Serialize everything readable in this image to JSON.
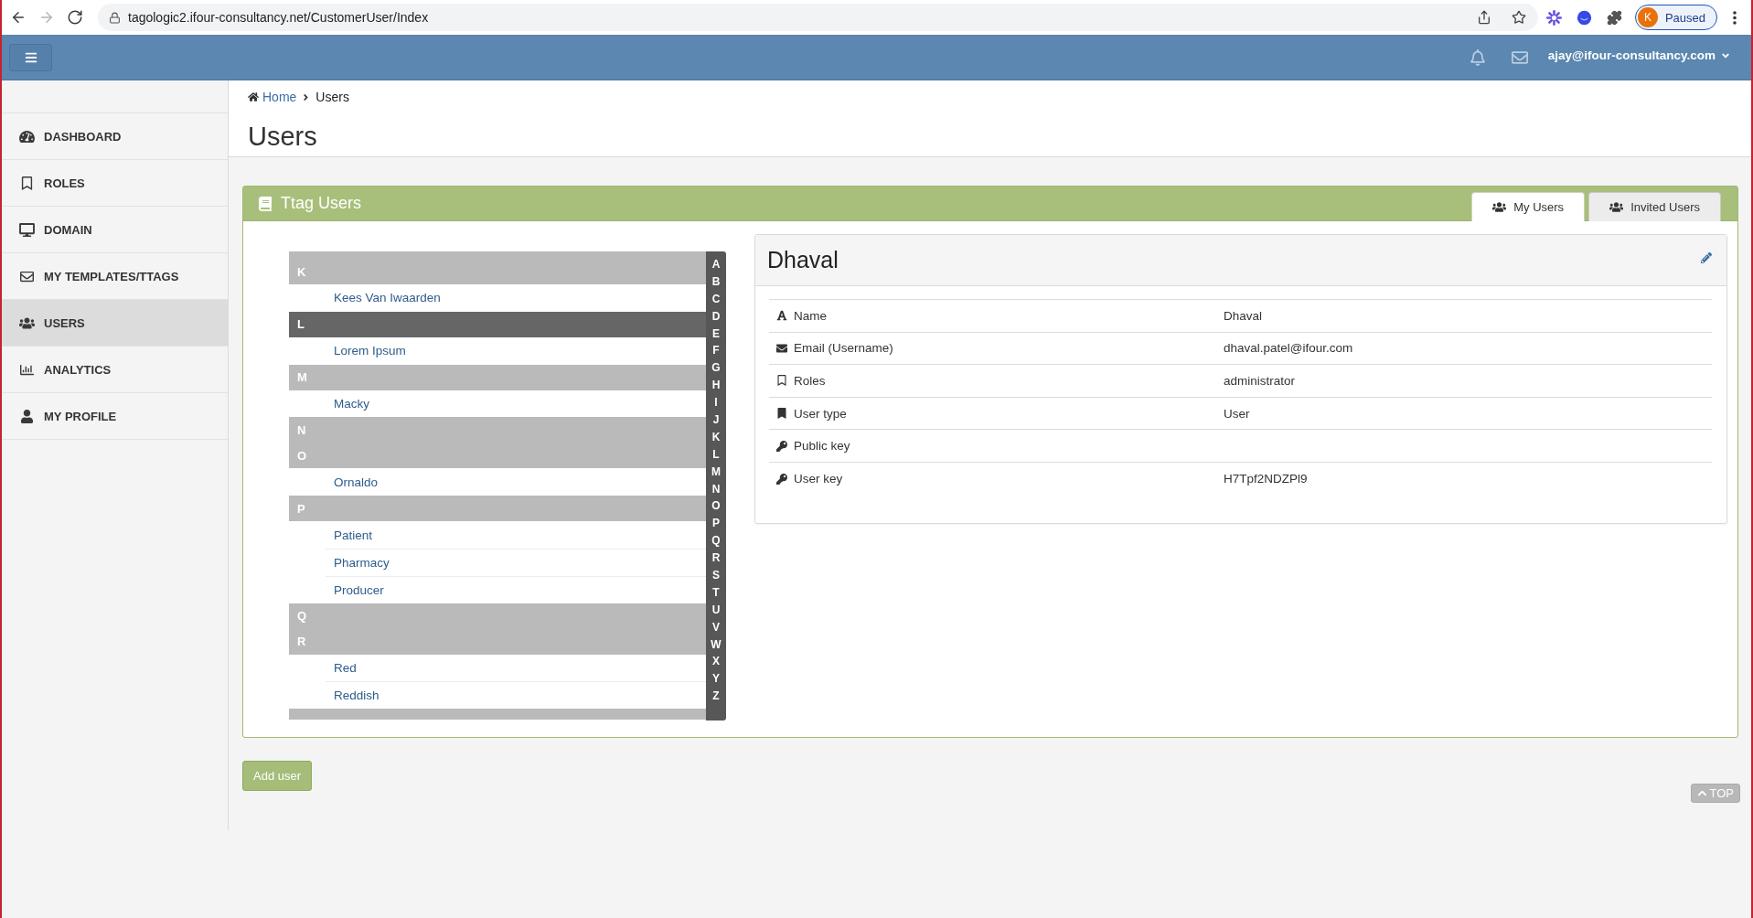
{
  "browser": {
    "url": "tagologic2.ifour-consultancy.net/CustomerUser/Index",
    "forward_enabled": false,
    "profile": {
      "initial": "K",
      "status": "Paused"
    }
  },
  "top_bar": {
    "user_email": "ajay@ifour-consultancy.com"
  },
  "sidebar": {
    "items": [
      {
        "label": "DASHBOARD",
        "selected": false
      },
      {
        "label": "ROLES",
        "selected": false
      },
      {
        "label": "DOMAIN",
        "selected": false
      },
      {
        "label": "MY TEMPLATES/TTAGS",
        "selected": false
      },
      {
        "label": "USERS",
        "selected": true
      },
      {
        "label": "ANALYTICS",
        "selected": false
      },
      {
        "label": "MY PROFILE",
        "selected": false
      }
    ]
  },
  "breadcrumb": [
    {
      "label": "Home",
      "kind": "link"
    },
    {
      "label": "Users",
      "kind": "current"
    }
  ],
  "page_title": "Users",
  "panel": {
    "title": "Ttag Users",
    "tabs": [
      {
        "label": "My Users",
        "selected": true
      },
      {
        "label": "Invited Users",
        "selected": false
      }
    ],
    "user_list": {
      "groups": [
        {
          "letter": "K",
          "selected": false,
          "users": [
            "Kees Van Iwaarden"
          ]
        },
        {
          "letter": "L",
          "selected": true,
          "users": [
            "Lorem Ipsum"
          ]
        },
        {
          "letter": "M",
          "selected": false,
          "users": [
            "Macky"
          ]
        },
        {
          "letter": "N",
          "selected": false
        },
        {
          "letter": "O",
          "selected": false,
          "users": [
            "Ornaldo"
          ]
        },
        {
          "letter": "P",
          "selected": false,
          "users": [
            "Patient",
            "Pharmacy",
            "Producer"
          ]
        },
        {
          "letter": "Q",
          "selected": false
        },
        {
          "letter": "R",
          "selected": false,
          "users": [
            "Red",
            "Reddish"
          ]
        }
      ],
      "index": [
        "A",
        "B",
        "C",
        "D",
        "E",
        "F",
        "G",
        "H",
        "I",
        "J",
        "K",
        "L",
        "M",
        "N",
        "O",
        "P",
        "Q",
        "R",
        "S",
        "T",
        "U",
        "V",
        "W",
        "X",
        "Y",
        "Z"
      ]
    },
    "user_detail": {
      "name": "Dhaval",
      "fields": [
        {
          "label": "Name",
          "value": "Dhaval"
        },
        {
          "label": "Email (Username)",
          "value": "dhaval.patel@ifour.com"
        },
        {
          "label": "Roles",
          "value": "administrator"
        },
        {
          "label": "User type",
          "value": "User"
        },
        {
          "label": "Public key"
        },
        {
          "label": "User key",
          "value": "H7Tpf2NDZPl9"
        }
      ]
    }
  },
  "add_user_button": "Add user",
  "top_button": "TOP"
}
